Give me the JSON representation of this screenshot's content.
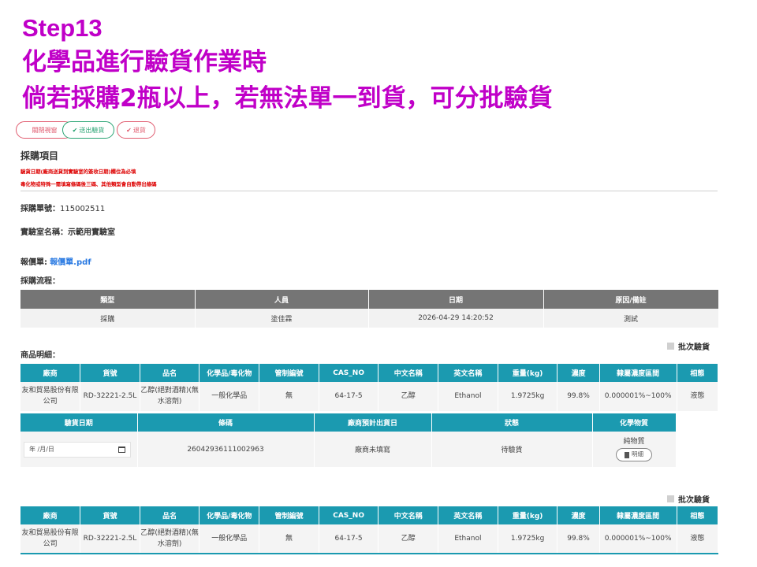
{
  "headings": {
    "step": "Step13",
    "line1": "化學品進行驗貨作業時",
    "line2": "倘若採購2瓶以上，若無法單一到貨，可分批驗貨"
  },
  "toolbar": {
    "close_label": "關閉視窗",
    "send_label": "送出驗貨",
    "return_label": "退貨"
  },
  "section": {
    "title": "採購項目",
    "note1": "驗貨日期(廠商送貨到實驗室的簽收日期)欄位為必填",
    "note2": "毒化物或特殊一需填寫條碼後三碼、其他類型會自動帶出條碼"
  },
  "info": {
    "po_label": "採購單號：",
    "po_value": "115002511",
    "lab_label": "實驗室名稱：",
    "lab_value": "示範用實驗室",
    "quote_label": "報價單:",
    "quote_file": "報價單.pdf",
    "flow_label": "採購流程："
  },
  "flow_table": {
    "headers": [
      "類型",
      "人員",
      "日期",
      "原因/備註"
    ],
    "row": [
      "採購",
      "塗佳霖",
      "2026-04-29 14:20:52",
      "測試"
    ]
  },
  "goods_title": "商品明細：",
  "batch_label": "批次驗貨",
  "goods_headers": [
    "廠商",
    "貨號",
    "品名",
    "化學品/毒化物",
    "管制編號",
    "CAS_NO",
    "中文名稱",
    "英文名稱",
    "重量(kg)",
    "濃度",
    "隸屬濃度區間",
    "相態"
  ],
  "goods_rows": [
    {
      "vendor": "友和貿易股份有限公司",
      "item_no": "RD-32221-2.5L",
      "product": "乙醇(絕對酒精)(無水溶劑)",
      "type": "一般化學品",
      "control_no": "無",
      "cas": "64-17-5",
      "cn_name": "乙醇",
      "en_name": "Ethanol",
      "weight": "1.9725kg",
      "concentration": "99.8%",
      "range": "0.000001%~100%",
      "phase": "液態"
    },
    {
      "vendor": "友和貿易股份有限公司",
      "item_no": "RD-32221-2.5L",
      "product": "乙醇(絕對酒精)(無水溶劑)",
      "type": "一般化學品",
      "control_no": "無",
      "cas": "64-17-5",
      "cn_name": "乙醇",
      "en_name": "Ethanol",
      "weight": "1.9725kg",
      "concentration": "99.8%",
      "range": "0.000001%~100%",
      "phase": "液態"
    }
  ],
  "detail": {
    "headers": [
      "驗貨日期",
      "條碼",
      "廠商預計出貨日",
      "狀態",
      "化學物質"
    ],
    "date_placeholder": "年 /月/日",
    "barcode": "26042936111002963",
    "ship_date": "廠商未填寫",
    "status": "待驗貨",
    "substance": "純物質",
    "detail_button": "明細"
  },
  "colors": {
    "heading": "#c000c8",
    "table_header_teal": "#1b9ab0",
    "flow_header_gray": "#757575",
    "danger": "#e05a6e",
    "success": "#27a372",
    "note_red": "#dd0000",
    "link_blue": "#2a7ae2"
  }
}
